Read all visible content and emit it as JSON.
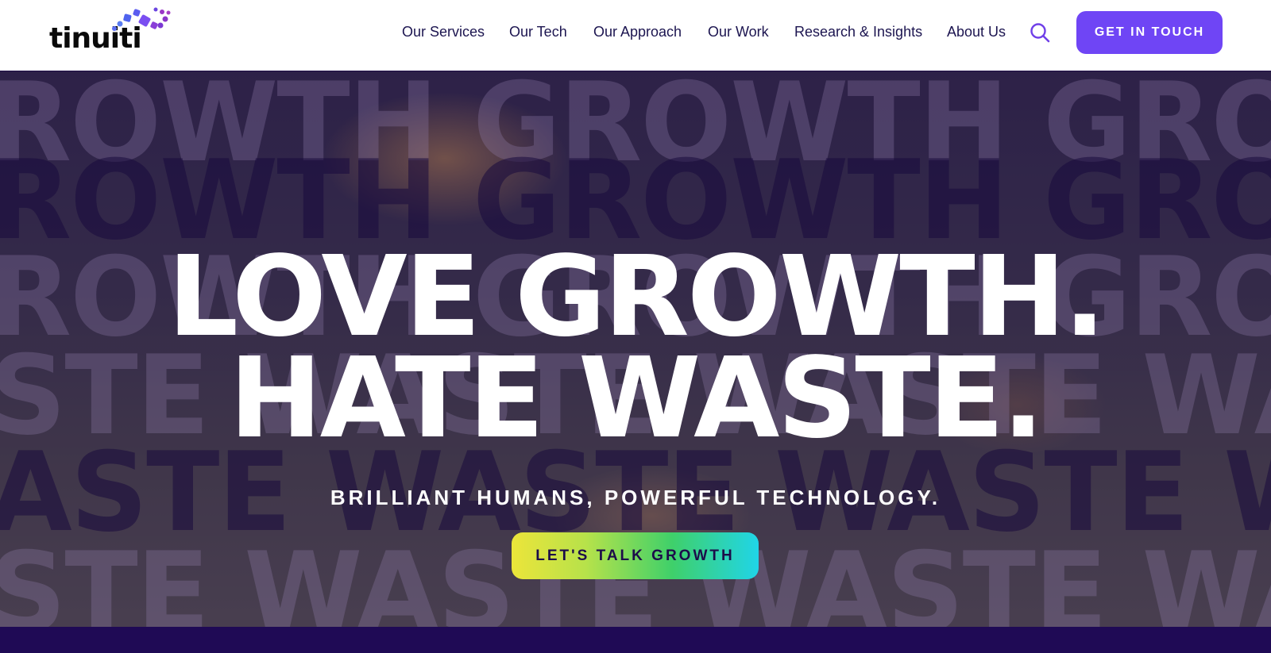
{
  "brand": {
    "logo_text": "tinuiti",
    "accent": "#6f45f5",
    "dark": "#1c0c4a"
  },
  "nav": {
    "items": [
      {
        "label": "Our Services"
      },
      {
        "label": "Our Tech"
      },
      {
        "label": "Our Approach"
      },
      {
        "label": "Our Work"
      },
      {
        "label": "Research & Insights"
      },
      {
        "label": "About Us"
      }
    ],
    "search_icon": "search-icon",
    "cta_label": "GET IN TOUCH"
  },
  "hero": {
    "bg_rows": [
      "ROWTH GROWTH GROWTH G",
      "ROWTH GROWTH GROWTH G",
      "ROWTH GROWTH GROWTH G",
      "STE WASTE WASTE WASTE W",
      "ASTE WASTE WASTE WASTE",
      "STE WASTE WASTE WASTE W"
    ],
    "headline_line1": "LOVE GROWTH.",
    "headline_line2": "HATE WASTE.",
    "subline": "BRILLIANT HUMANS, POWERFUL TECHNOLOGY.",
    "cta_label": "LET'S TALK GROWTH"
  }
}
